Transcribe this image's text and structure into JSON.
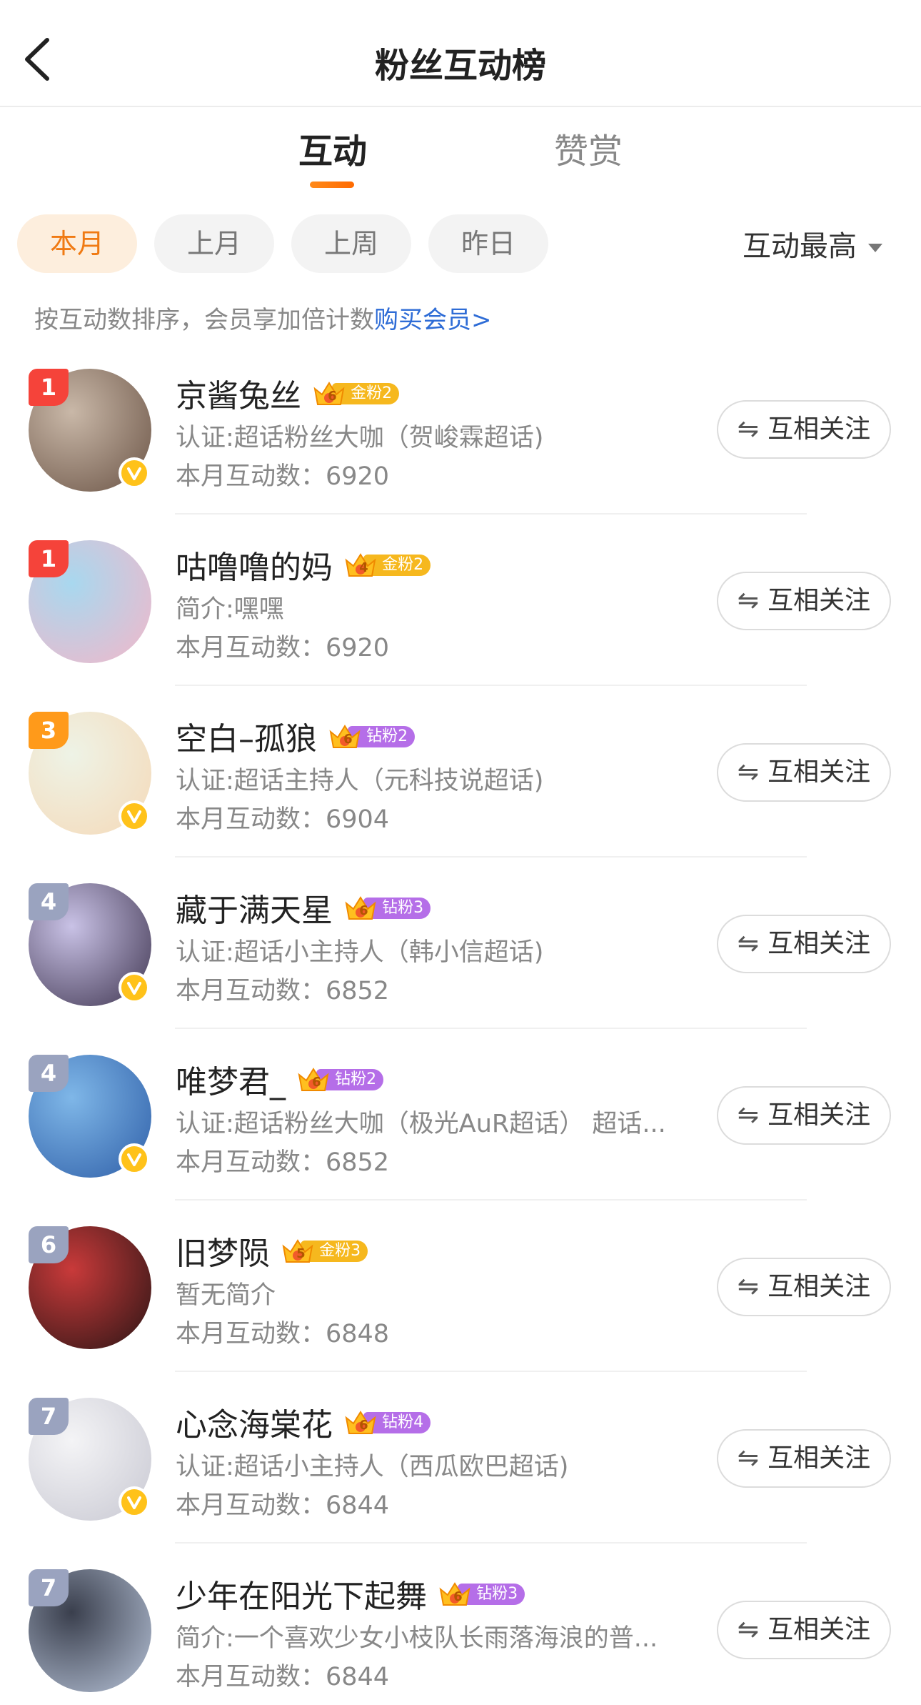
{
  "header": {
    "title": "粉丝互动榜",
    "back_icon": "chevron-left-icon"
  },
  "tabs": [
    {
      "label": "互动",
      "active": true
    },
    {
      "label": "赞赏",
      "active": false
    }
  ],
  "filters": {
    "chips": [
      {
        "label": "本月",
        "active": true
      },
      {
        "label": "上月",
        "active": false
      },
      {
        "label": "上周",
        "active": false
      },
      {
        "label": "昨日",
        "active": false
      }
    ],
    "sort_label": "互动最高"
  },
  "notice": {
    "text": "按互动数排序，会员享加倍计数",
    "link": "购买会员>"
  },
  "colors": {
    "accent": "#ff7a0a",
    "link": "#2e6cd6",
    "gold_badge": "#f6b81e",
    "diamond_badge": "#b56ee8"
  },
  "follow_label": "互相关注",
  "fans": [
    {
      "rank": "1",
      "rank_color": "#f5433a",
      "name": "京酱兔丝",
      "badge": "金粉2",
      "badge_level": "6",
      "badge_color": "#f6b81e",
      "desc": "认证:超话粉丝大咖（贺峻霖超话)",
      "count": "本月互动数：6920",
      "verified": true,
      "avatar_colors": [
        "#c9b8a8",
        "#6b5446"
      ]
    },
    {
      "rank": "1",
      "rank_color": "#f5433a",
      "name": "咕噜噜的妈",
      "badge": "金粉2",
      "badge_level": "4",
      "badge_color": "#f6b81e",
      "desc": "简介:嘿嘿",
      "count": "本月互动数：6920",
      "verified": false,
      "avatar_colors": [
        "#a8d8ef",
        "#f3b7c9"
      ]
    },
    {
      "rank": "3",
      "rank_color": "#ff9a1a",
      "name": "空白–孤狼",
      "badge": "钻粉2",
      "badge_level": "6",
      "badge_color": "#b56ee8",
      "desc": "认证:超话主持人（元科技说超话)",
      "count": "本月互动数：6904",
      "verified": true,
      "avatar_colors": [
        "#eef3e6",
        "#f5d9b8"
      ]
    },
    {
      "rank": "4",
      "rank_color": "#9aa3bf",
      "name": "藏于满天星",
      "badge": "钻粉3",
      "badge_level": "6",
      "badge_color": "#b56ee8",
      "desc": "认证:超话小主持人（韩小信超话)",
      "count": "本月互动数：6852",
      "verified": true,
      "avatar_colors": [
        "#c9c2e6",
        "#3f3550"
      ]
    },
    {
      "rank": "4",
      "rank_color": "#9aa3bf",
      "name": "唯梦君_",
      "badge": "钻粉2",
      "badge_level": "6",
      "badge_color": "#b56ee8",
      "desc": "认证:超话粉丝大咖（极光AuR超话） 超话...",
      "count": "本月互动数：6852",
      "verified": true,
      "avatar_colors": [
        "#7fb7e8",
        "#2f5fa8"
      ]
    },
    {
      "rank": "6",
      "rank_color": "#9aa3bf",
      "name": "旧梦陨",
      "badge": "金粉3",
      "badge_level": "5",
      "badge_color": "#f6b81e",
      "desc": "暂无简介",
      "count": "本月互动数：6848",
      "verified": false,
      "avatar_colors": [
        "#c93a3a",
        "#2a1515"
      ]
    },
    {
      "rank": "7",
      "rank_color": "#9aa3bf",
      "name": "心念海棠花",
      "badge": "钻粉4",
      "badge_level": "6",
      "badge_color": "#b56ee8",
      "desc": "认证:超话小主持人（西瓜欧巴超话)",
      "count": "本月互动数：6844",
      "verified": true,
      "avatar_colors": [
        "#f4f4f6",
        "#c8c8d2"
      ]
    },
    {
      "rank": "7",
      "rank_color": "#9aa3bf",
      "name": "少年在阳光下起舞",
      "badge": "钻粉3",
      "badge_level": "6",
      "badge_color": "#b56ee8",
      "desc": "简介:一个喜欢少女小枝队长雨落海浪的普...",
      "count": "本月互动数：6844",
      "verified": false,
      "avatar_colors": [
        "#3a3f4d",
        "#b7c3d8"
      ]
    }
  ]
}
